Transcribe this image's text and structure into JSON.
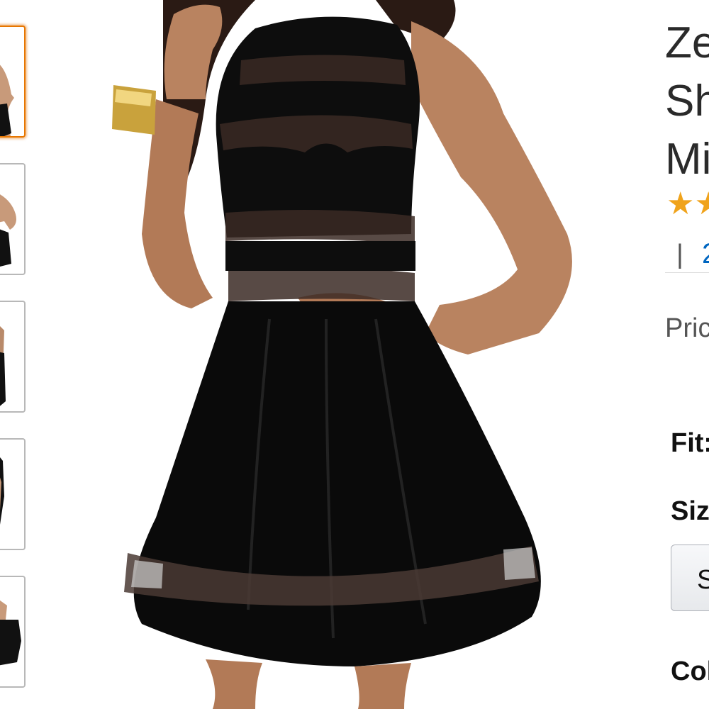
{
  "thumbnails": [
    {
      "label": "",
      "active": true
    },
    {
      "label": "",
      "active": false
    },
    {
      "label": "",
      "active": false
    },
    {
      "label": "",
      "active": false
    },
    {
      "label": "",
      "active": false
    }
  ],
  "product": {
    "title_line_1": "Ze",
    "title_line_2": "Sh",
    "title_line_3": "Mi",
    "rating_separator": "|",
    "rating_count": "2",
    "price_label": "Pric",
    "fit_label": "Fit:",
    "size_label": "Siz",
    "size_button": "S",
    "color_label": "Col"
  },
  "colors": {
    "accent_orange": "#e77600",
    "link_blue": "#0066c0",
    "star_gold": "#f0a31b"
  },
  "icons": {
    "rating": "star-icon"
  }
}
